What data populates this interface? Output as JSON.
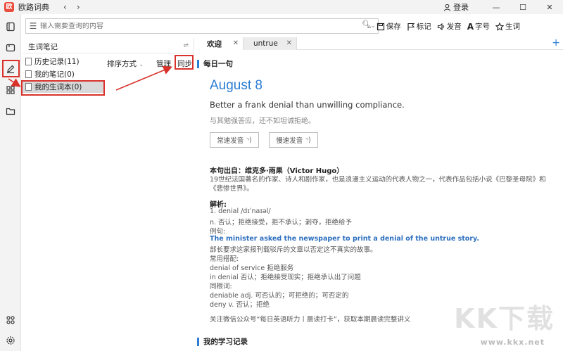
{
  "titlebar": {
    "app_name": "欧路词典",
    "back": "‹",
    "forward": "›",
    "login": "登录",
    "minimize": "—",
    "maximize": "☐",
    "close": "✕"
  },
  "search": {
    "placeholder": "输入需要查询的内容"
  },
  "toolbar": {
    "save": "保存",
    "mark": "标记",
    "pronounce": "发音",
    "font": "字号",
    "vocab": "生词"
  },
  "wordpanel": {
    "title": "生词笔记",
    "items": [
      {
        "label": "历史记录(11)"
      },
      {
        "label": "我的笔记(0)"
      },
      {
        "label": "我的生词本(0)"
      }
    ],
    "sort_label": "排序方式",
    "manage_label": "管理",
    "sync_label": "同步"
  },
  "tabs": [
    {
      "label": "欢迎"
    },
    {
      "label": "untrue"
    }
  ],
  "content": {
    "daily_heading": "每日一句",
    "date": "August 8",
    "quote_en": "Better a frank denial than unwilling compliance.",
    "quote_cn": "与其勉强答应，还不如坦诚拒绝。",
    "normal_speed": "常速发音",
    "slow_speed": "慢速发音",
    "source_label": "本句出自：维克多·雨果（Victor Hugo）",
    "source_desc_1": "19世纪法国著名的作家、诗人和剧作家，也是浪漫主义运动的代表人物之一，代表作品包括小说《巴黎圣母院》和",
    "source_desc_2": "《悲惨世界》。",
    "analysis_label": "解析:",
    "lines": [
      "1. denial /dɪˈnaɪəl/",
      "n. 否认；拒绝接受，拒不承认；剥夺，拒绝给予",
      "例句:"
    ],
    "example_en": "The minister asked the newspaper to print a denial of the untrue story.",
    "lines2": [
      "部长要求这家报刊载驳斥的文章以否定这不真实的故事。",
      "常用搭配:",
      "denial of service 拒绝服务",
      "in denial 否认；拒绝接受现实；拒绝承认出了问题",
      "同根词:",
      "deniable adj. 可否认的；可拒绝的；可否定的",
      "deny v. 否认；拒绝"
    ],
    "follow_note": "关注微信公众号“每日英语听力丨晨读打卡”，获取本期晨读完整讲义",
    "study_heading": "我的学习记录"
  },
  "watermark": {
    "text": "KK下载",
    "url": "www.kkx.net"
  }
}
